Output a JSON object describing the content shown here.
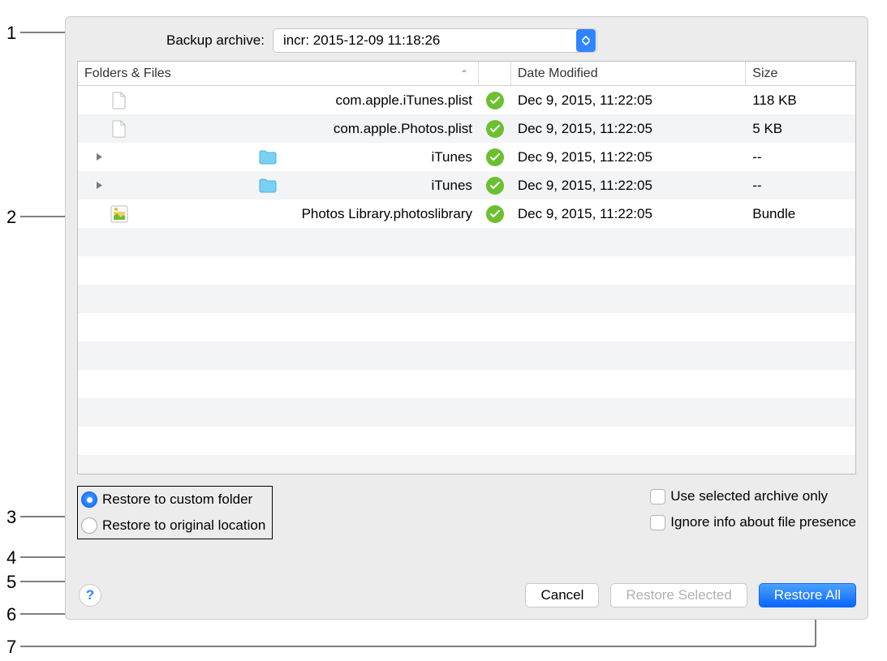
{
  "callouts": [
    "1",
    "2",
    "3",
    "4",
    "5",
    "6",
    "7"
  ],
  "archive": {
    "label": "Backup archive:",
    "selected": "incr: 2015-12-09 11:18:26"
  },
  "columns": {
    "name": "Folders & Files",
    "date": "Date Modified",
    "size": "Size"
  },
  "rows": [
    {
      "icon": "file",
      "disclosure": false,
      "indent": "indent0",
      "name": "com.apple.iTunes.plist",
      "date": "Dec 9, 2015, 11:22:05",
      "size": "118 KB"
    },
    {
      "icon": "file",
      "disclosure": false,
      "indent": "indent0",
      "name": "com.apple.Photos.plist",
      "date": "Dec 9, 2015, 11:22:05",
      "size": "5 KB"
    },
    {
      "icon": "folder",
      "disclosure": true,
      "indent": "indent1",
      "name": "iTunes",
      "date": "Dec 9, 2015, 11:22:05",
      "size": "--"
    },
    {
      "icon": "folder",
      "disclosure": true,
      "indent": "indent1",
      "name": "iTunes",
      "date": "Dec 9, 2015, 11:22:05",
      "size": "--"
    },
    {
      "icon": "bundle",
      "disclosure": false,
      "indent": "indent0",
      "name": "Photos Library.photoslibrary",
      "date": "Dec 9, 2015, 11:22:05",
      "size": "Bundle"
    }
  ],
  "options": {
    "radio_custom": "Restore to custom folder",
    "radio_original": "Restore to original location",
    "check_archive_only": "Use selected archive only",
    "check_ignore_presence": "Ignore info about file presence"
  },
  "buttons": {
    "help": "?",
    "cancel": "Cancel",
    "restore_selected": "Restore Selected",
    "restore_all": "Restore All"
  }
}
